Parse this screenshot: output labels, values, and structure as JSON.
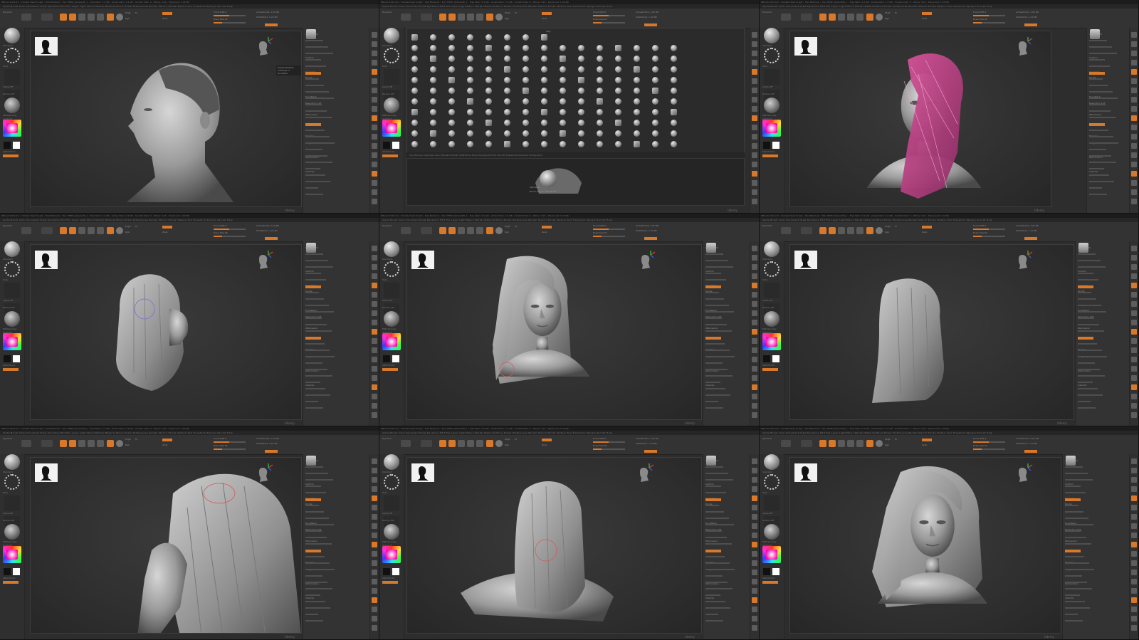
{
  "app": {
    "title_text": "ZBrush 2021.6.2 – Female Head Sculpt – Hair Blockout – Tool: PM3D_Sphere3D_1 – Free Mem: 5.2 GB – Active Mem: 1.9 GB – Scratch Disk: 0 – Ztime: 3.24 – PolyCount: 1.02 Mp",
    "menu_text": "Alpha  Brush  Color  Document  Draw  Dynamics  Edit  File  Layer  Light  Macro  Marker  Material  Movie  Picker  Preferences  Render  Stencil  Stroke  Texture  Tool  Transform  Zplugin  Zscript  Help",
    "accent_color": "#d8782a",
    "viewport_bg": "#2d2d2d",
    "watermark": "Udemy",
    "shelf": {
      "draw_label": "Draw",
      "move_label": "Move",
      "scale_label": "Scale",
      "rotate_label": "Rotate",
      "mrgb_label": "Mrgb",
      "rgb_label": "Rgb",
      "m_label": "M",
      "zadd_label": "Zadd",
      "zsub_label": "Zsub",
      "focal_label": "Focal Shift 0",
      "draw_size_label": "Draw Size 64",
      "rgb_intensity_label": "Rgb Intensity 100",
      "z_intensity_label": "Z Intensity 25",
      "active_points_label": "ActivePoints: 1.02 Mil",
      "total_points_label": "TotalPoints: 1.24 Mil",
      "dynamic_label": "Dynamic"
    },
    "tray": {
      "brush_label": "Standard",
      "stroke_label": "Dots",
      "alpha_label": "Alpha Off",
      "texture_label": "Texture Off",
      "material_label": "MatCap Gray",
      "gradient_label": "Gradient",
      "switch_label": "SwitchColor",
      "alternate_label": "Alternate"
    },
    "right_shelf_icons": [
      "bpr-icon",
      "spix-icon",
      "scroll-icon",
      "zoom-icon",
      "actual-icon",
      "aahalf-icon",
      "persp-icon",
      "floor-icon",
      "local-icon",
      "xyz-icon",
      "frame-icon",
      "move-icon",
      "scale-icon",
      "rotate-icon",
      "linefill-icon",
      "polyf-icon",
      "transp-icon",
      "solo-icon",
      "xpose-icon"
    ]
  },
  "panes": [
    {
      "id": "p1",
      "subject": "bald head profile",
      "tooltip": "Rotate Multiple SubTools in Turntable"
    },
    {
      "id": "p2",
      "subject": "brush palette",
      "palette_caption_1": "Clay",
      "palette_caption_2": "Clay Buildup  ClayTubes  Dam Standard  hPolish  Inflat  Move  Move Topological  Pinch  Smooth  Snakehook  Standard  TrimDynamic",
      "preview_caption": "Standard",
      "preview_sub": "Brush: Figure, Hair Brush"
    },
    {
      "id": "p3",
      "subject": "head with pink hair mesh"
    },
    {
      "id": "p4",
      "subject": "hair side view"
    },
    {
      "id": "p5",
      "subject": "head with hair three quarter"
    },
    {
      "id": "p6",
      "subject": "hair back view"
    },
    {
      "id": "p7",
      "subject": "hair close-up side"
    },
    {
      "id": "p8",
      "subject": "hair back on bust"
    },
    {
      "id": "p9",
      "subject": "final head with hair"
    }
  ],
  "panel_text": {
    "subtool": "SubTool",
    "geometry": "Geometry",
    "subdivide": "Divide",
    "dynamesh": "DynaMesh",
    "resolution": "Resolution 128",
    "zremesher": "ZRemesher",
    "masking": "Masking",
    "polygroups": "Polygroups",
    "deformation": "Deformation",
    "visibility": "Visibility"
  }
}
